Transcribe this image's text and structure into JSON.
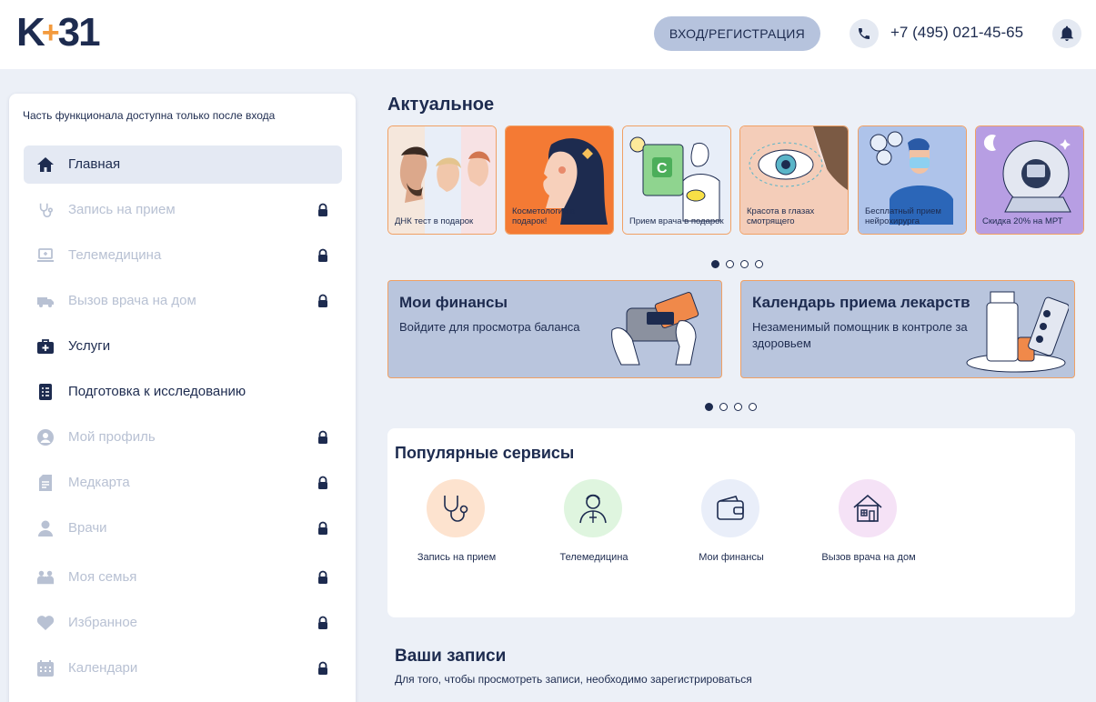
{
  "header": {
    "logo_left": "K",
    "logo_plus": "+",
    "logo_right": "31",
    "login_label": "ВХОД/РЕГИСТРАЦИЯ",
    "phone": "+7 (495) 021-45-65"
  },
  "sidebar": {
    "note": "Часть функционала доступна только после входа",
    "items": [
      {
        "label": "Главная",
        "icon": "home-icon",
        "locked": false,
        "active": true
      },
      {
        "label": "Запись на прием",
        "icon": "stethoscope-icon",
        "locked": true
      },
      {
        "label": "Телемедицина",
        "icon": "laptop-icon",
        "locked": true
      },
      {
        "label": "Вызов врача на дом",
        "icon": "ambulance-icon",
        "locked": true
      },
      {
        "label": "Услуги",
        "icon": "medkit-icon",
        "locked": false
      },
      {
        "label": "Подготовка к исследованию",
        "icon": "checklist-icon",
        "locked": false
      },
      {
        "label": "Мой профиль",
        "icon": "profile-icon",
        "locked": true
      },
      {
        "label": "Медкарта",
        "icon": "medcard-icon",
        "locked": true
      },
      {
        "label": "Врачи",
        "icon": "doctor-icon",
        "locked": true
      },
      {
        "label": "Моя семья",
        "icon": "family-icon",
        "locked": true
      },
      {
        "label": "Избранное",
        "icon": "heart-icon",
        "locked": true
      },
      {
        "label": "Календари",
        "icon": "calendar-icon",
        "locked": true
      }
    ]
  },
  "actual": {
    "title": "Актуальное",
    "cards": [
      {
        "label": "ДНК тест в подарок"
      },
      {
        "label": "Косметология в подарок!"
      },
      {
        "label": "Прием врача в подарок"
      },
      {
        "label": "Красота в глазах смотрящего"
      },
      {
        "label": "Бесплатный прием нейрохирурга"
      },
      {
        "label": "Скидка 20% на МРТ"
      }
    ]
  },
  "features": [
    {
      "title": "Мои финансы",
      "text": "Войдите для просмотра баланса"
    },
    {
      "title": "Календарь приема лекарств",
      "text": "Незаменимый помощник в контроле за здоровьем"
    }
  ],
  "services": {
    "title": "Популярные сервисы",
    "items": [
      {
        "label": "Запись на прием",
        "color": "#fde3cf"
      },
      {
        "label": "Телемедицина",
        "color": "#dff5df"
      },
      {
        "label": "Мои финансы",
        "color": "#e9eef9"
      },
      {
        "label": "Вызов врача на дом",
        "color": "#f5e2f6"
      }
    ]
  },
  "records": {
    "title": "Ваши записи",
    "text": "Для того, чтобы просмотреть записи, необходимо зарегистрироваться"
  },
  "colors": {
    "navy": "#1d2b4f",
    "accent": "#f39a3d",
    "background": "#ecf0f7"
  }
}
